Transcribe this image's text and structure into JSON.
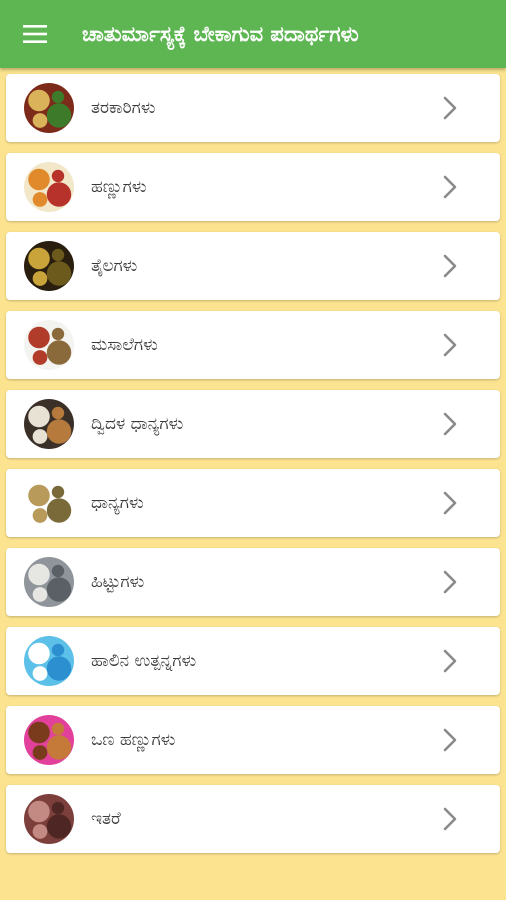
{
  "app_bar": {
    "menu_icon": "hamburger-menu-icon",
    "title": "ಚಾತುರ್ಮಾಸ್ಯಕ್ಕೆ ಬೇಕಾಗುವ ಪದಾರ್ಥಗಳು"
  },
  "items": [
    {
      "label": "ತರಕಾರಿಗಳು",
      "thumb_colors": [
        "#7e2a1a",
        "#d9b25a",
        "#3d7a2a"
      ]
    },
    {
      "label": "ಹಣ್ಣುಗಳು",
      "thumb_colors": [
        "#f2e7c8",
        "#e08a2c",
        "#b6322a"
      ]
    },
    {
      "label": "ತೈಲಗಳು",
      "thumb_colors": [
        "#2a1f0f",
        "#c9a43a",
        "#6b5a1c"
      ]
    },
    {
      "label": "ಮಸಾಲೆಗಳು",
      "thumb_colors": [
        "#f3f3f0",
        "#b23c2a",
        "#8a6a3a"
      ]
    },
    {
      "label": "ದ್ವಿದಳ ಧಾನ್ಯಗಳು",
      "thumb_colors": [
        "#3b3028",
        "#e8e2d4",
        "#b77a3d"
      ]
    },
    {
      "label": "ಧಾನ್ಯಗಳು",
      "thumb_colors": [
        "#ffffff",
        "#b89a5a",
        "#7a6a3a"
      ]
    },
    {
      "label": "ಹಿಟ್ಟುಗಳು",
      "thumb_colors": [
        "#8f959a",
        "#e6e6e3",
        "#5a6066"
      ]
    },
    {
      "label": "ಹಾಲಿನ ಉತ್ಪನ್ನಗಳು",
      "thumb_colors": [
        "#5cc0e8",
        "#ffffff",
        "#2b8fd0"
      ]
    },
    {
      "label": "ಒಣ ಹಣ್ಣುಗಳು",
      "thumb_colors": [
        "#e1419a",
        "#7a3a1c",
        "#c67a3a"
      ]
    },
    {
      "label": "ಇತರೆ",
      "thumb_colors": [
        "#7c3f3c",
        "#c28a82",
        "#4e2623"
      ]
    }
  ],
  "chevron_icon": "chevron-right-icon",
  "colors": {
    "app_bar": "#5db652",
    "background": "#fbe38f",
    "card": "#ffffff",
    "chevron": "#8a8a8a"
  }
}
